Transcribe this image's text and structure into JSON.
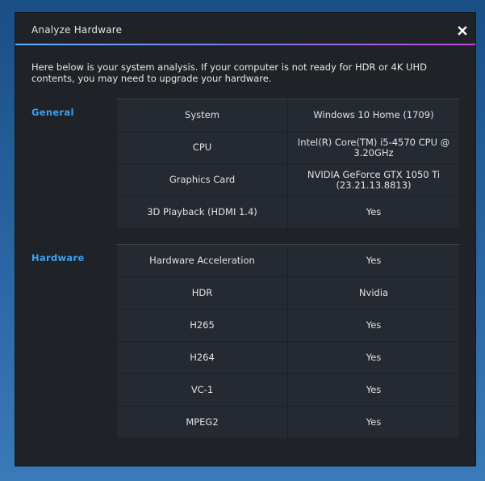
{
  "dialog": {
    "title": "Analyze Hardware",
    "intro": "Here below is your system analysis. If your computer is not ready for HDR or 4K UHD contents, you may need to upgrade your hardware."
  },
  "general": {
    "label": "General",
    "rows": [
      {
        "key": "System",
        "value": "Windows 10 Home (1709)"
      },
      {
        "key": "CPU",
        "value": "Intel(R) Core(TM) i5-4570 CPU @ 3.20GHz"
      },
      {
        "key": "Graphics Card",
        "value": "NVIDIA GeForce GTX 1050 Ti (23.21.13.8813)"
      },
      {
        "key": "3D Playback (HDMI 1.4)",
        "value": "Yes"
      }
    ]
  },
  "hardware": {
    "label": "Hardware",
    "rows": [
      {
        "key": "Hardware Acceleration",
        "value": "Yes"
      },
      {
        "key": "HDR",
        "value": "Nvidia"
      },
      {
        "key": "H265",
        "value": "Yes"
      },
      {
        "key": "H264",
        "value": "Yes"
      },
      {
        "key": "VC-1",
        "value": "Yes"
      },
      {
        "key": "MPEG2",
        "value": "Yes"
      }
    ]
  },
  "colors": {
    "accent": "#3ea0f0",
    "dialog_bg": "#1f2226",
    "table_bg": "#252a32"
  },
  "icons": {
    "close": "close-icon"
  }
}
